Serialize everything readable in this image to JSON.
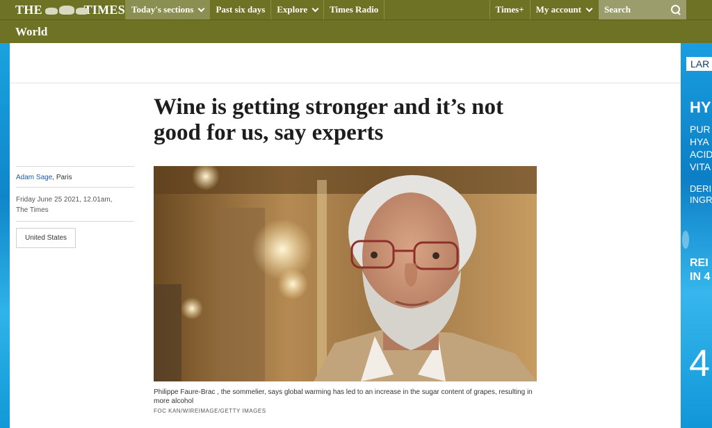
{
  "masthead": {
    "logo_left": "THE",
    "logo_right": "TIMES"
  },
  "nav": {
    "items": [
      {
        "label": "Today's sections",
        "has_dropdown": true,
        "active": true
      },
      {
        "label": "Past six days",
        "has_dropdown": false
      },
      {
        "label": "Explore",
        "has_dropdown": true
      },
      {
        "label": "Times Radio",
        "has_dropdown": false
      }
    ],
    "right_items": [
      {
        "label": "Times+",
        "has_dropdown": false
      },
      {
        "label": "My account",
        "has_dropdown": true
      }
    ],
    "search_label": "Search"
  },
  "section": {
    "title": "World"
  },
  "article": {
    "headline": "Wine is getting stronger and it’s not good for us, say experts",
    "author": "Adam Sage",
    "location": ", Paris",
    "date_line1": "Friday June 25 2021, 12.01am,",
    "date_line2": "The Times",
    "tag": "United States",
    "image_caption": "Philippe Faure-Brac , the sommelier, says global warming has led to an increase in the sugar content of grapes, resulting in more alcohol",
    "image_credit": "FOC KAN/WIREIMAGE/GETTY IMAGES"
  },
  "side_ad": {
    "brand": "LAR",
    "heading": "HY",
    "lines": [
      "PUR",
      "HYA",
      "ACID",
      "VITA",
      "DERI",
      "INGR",
      "REI",
      "IN 4"
    ],
    "number": "4"
  },
  "colors": {
    "nav_bg": "#6d7224",
    "link": "#1e5aa8",
    "ad_blue": "#0f86c8"
  }
}
